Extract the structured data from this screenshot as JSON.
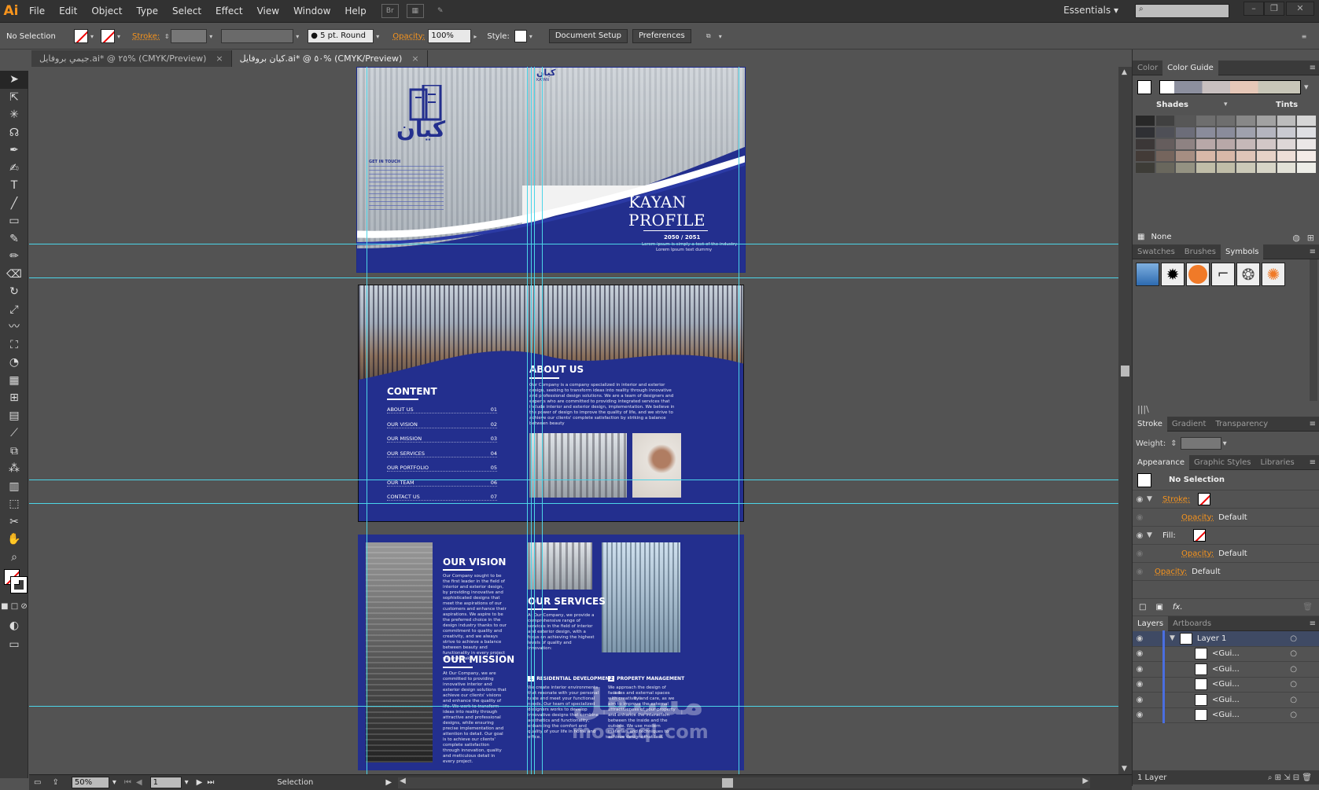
{
  "app": {
    "logo": "Ai"
  },
  "menu": [
    "File",
    "Edit",
    "Object",
    "Type",
    "Select",
    "Effect",
    "View",
    "Window",
    "Help"
  ],
  "menubar": {
    "br_label": "Br",
    "workspace": "Essentials"
  },
  "control": {
    "selection": "No Selection",
    "stroke_label": "Stroke:",
    "brush": "5 pt. Round",
    "opacity_label": "Opacity:",
    "opacity_value": "100%",
    "style_label": "Style:",
    "doc_setup": "Document Setup",
    "preferences": "Preferences"
  },
  "tabs": [
    {
      "label": "جيمي بروفايل.ai* @ ٢٥% (CMYK/Preview)",
      "close": "×"
    },
    {
      "label": "كيان بروفايل.ai* @ ٥٠% (CMYK/Preview)",
      "close": "×"
    }
  ],
  "document": {
    "cover": {
      "logo_arabic": "كيان",
      "logo_latin": "KAYAN",
      "title_line1": "KAYAN",
      "title_line2": "PROFILE",
      "year": "2050 / 2051",
      "tagline": "Lorem ipsum is simply a text of the industry",
      "tagline2": "Lorem Ipsum text dummy",
      "get_in_touch": "GET IN TOUCH"
    },
    "content_title": "CONTENT",
    "toc": [
      {
        "label": "ABOUT US",
        "num": "01"
      },
      {
        "label": "OUR VISION",
        "num": "02"
      },
      {
        "label": "OUR MISSION",
        "num": "03"
      },
      {
        "label": "OUR SERVICES",
        "num": "04"
      },
      {
        "label": "OUR PORTFOLIO",
        "num": "05"
      },
      {
        "label": "OUR TEAM",
        "num": "06"
      },
      {
        "label": "CONTACT US",
        "num": "07"
      }
    ],
    "about_title": "ABOUT US",
    "about_text": "Our Company is a company specialized in interior and exterior design, seeking to transform ideas into reality through innovative and professional design solutions. We are a team of designers and experts who are committed to providing integrated services that include interior and exterior design, implementation. We believe in the power of design to improve the quality of life, and we strive to achieve our clients' complete satisfaction by striking a balance between beauty",
    "vision_title": "OUR VISION",
    "vision_text": "Our Company sought to be the first leader in the field of interior and exterior design, by providing innovative and sophisticated designs that meet the aspirations of our customers and enhance their aspirations. We aspire to be the preferred choice in the design industry thanks to our commitment to quality and creativity, and we always strive to achieve a balance between beauty and functionality in every project we undertake.",
    "mission_title": "OUR MISSION",
    "mission_text": "At Our Company, we are committed to providing innovative interior and exterior design solutions that achieve our clients' visions and enhance the quality of life. We work to transform ideas into reality through attractive and professional designs, while ensuring precise implementation and attention to detail. Our goal is to achieve our clients' complete satisfaction through innovation, quality and meticulous detail in every project.",
    "services_title": "OUR SERVICES",
    "services_text": "At Our Company, we provide a comprehensive range of services in the field of interior and exterior design, with a focus on achieving the highest levels of quality and innovation:",
    "service1_title": "RESIDENTIAL DEVELOPMENT",
    "service1_num": "1",
    "service1_text": "We create interior environments that resonate with your personal taste and meet your functional needs. Our team of specialized designers works to develop innovative designs that combine aesthetics and functionality, enhancing the comfort and quality of your life in home and office.",
    "service2_title": "PROPERTY MANAGEMENT",
    "service2_num": "2",
    "service2_text": "We approach the design of facades and external spaces with creativity and care, as we aim to improve the external attractiveness of your property and enhance the interaction between the inside and the outside. We use modern materials and techniques to achieve designs that last."
  },
  "watermark": {
    "arabic": "مستقل",
    "latin": "mostaql.com"
  },
  "panels": {
    "color_tabs": [
      "Color",
      "Color Guide"
    ],
    "shades_label": "Shades",
    "tints_label": "Tints",
    "none_label": "None",
    "symbol_tabs": [
      "Swatches",
      "Brushes",
      "Symbols"
    ],
    "stroke_tabs": [
      "Stroke",
      "Gradient",
      "Transparency"
    ],
    "weight_label": "Weight:",
    "appearance_tabs": [
      "Appearance",
      "Graphic Styles",
      "Libraries"
    ],
    "appearance": {
      "no_selection": "No Selection",
      "stroke": "Stroke:",
      "opacity": "Opacity:",
      "default": "Default",
      "fill": "Fill:",
      "fx": "fx."
    },
    "layer_tabs": [
      "Layers",
      "Artboards"
    ],
    "layers": [
      "Layer 1",
      "<Gui...",
      "<Gui...",
      "<Gui...",
      "<Gui...",
      "<Gui..."
    ],
    "layer_count": "1 Layer"
  },
  "status": {
    "zoom": "50%",
    "page": "1",
    "tool": "Selection"
  },
  "colors": {
    "brand_blue": "#232f8e",
    "guide": "#4cd5e8",
    "accent_orange": "#f7941d"
  },
  "tools": [
    "selection-tool-icon",
    "direct-selection-tool-icon",
    "magic-wand-tool-icon",
    "lasso-tool-icon",
    "pen-tool-icon",
    "curvature-tool-icon",
    "type-tool-icon",
    "line-tool-icon",
    "rectangle-tool-icon",
    "paintbrush-tool-icon",
    "pencil-tool-icon",
    "eraser-tool-icon",
    "rotate-tool-icon",
    "scale-tool-icon",
    "warp-tool-icon",
    "free-transform-tool-icon",
    "shape-builder-tool-icon",
    "perspective-tool-icon",
    "mesh-tool-icon",
    "gradient-tool-icon",
    "eyedropper-tool-icon",
    "blend-tool-icon",
    "symbol-sprayer-tool-icon",
    "column-graph-tool-icon",
    "artboard-tool-icon",
    "slice-tool-icon",
    "hand-tool-icon",
    "zoom-tool-icon"
  ]
}
